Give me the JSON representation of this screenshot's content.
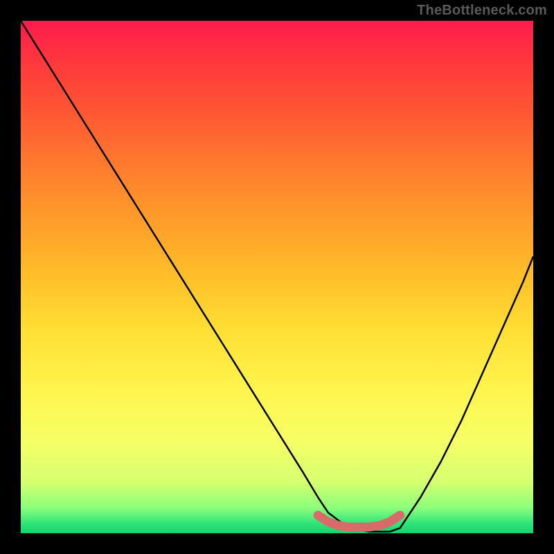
{
  "attribution": "TheBottleneck.com",
  "chart_data": {
    "type": "line",
    "title": "",
    "xlabel": "",
    "ylabel": "",
    "xlim": [
      0,
      100
    ],
    "ylim": [
      0,
      100
    ],
    "series": [
      {
        "name": "bottleneck-curve",
        "x": [
          0,
          5,
          10,
          15,
          20,
          25,
          30,
          35,
          40,
          45,
          50,
          55,
          58,
          60,
          64,
          68,
          72,
          74,
          78,
          82,
          86,
          90,
          94,
          98,
          100
        ],
        "y": [
          100,
          92,
          84,
          76,
          68,
          60,
          52,
          44,
          36,
          28,
          20,
          12,
          7,
          4,
          1,
          0.3,
          0.3,
          1,
          7,
          14,
          22,
          31,
          40,
          49,
          54
        ]
      },
      {
        "name": "optimal-range-marker",
        "x": [
          58,
          60,
          62,
          64,
          66,
          68,
          70,
          72,
          74
        ],
        "y": [
          3.5,
          2.2,
          1.5,
          1.2,
          1.2,
          1.2,
          1.5,
          2.2,
          3.5
        ]
      }
    ],
    "marker_color": "#d96a6a",
    "curve_color": "#000000"
  }
}
